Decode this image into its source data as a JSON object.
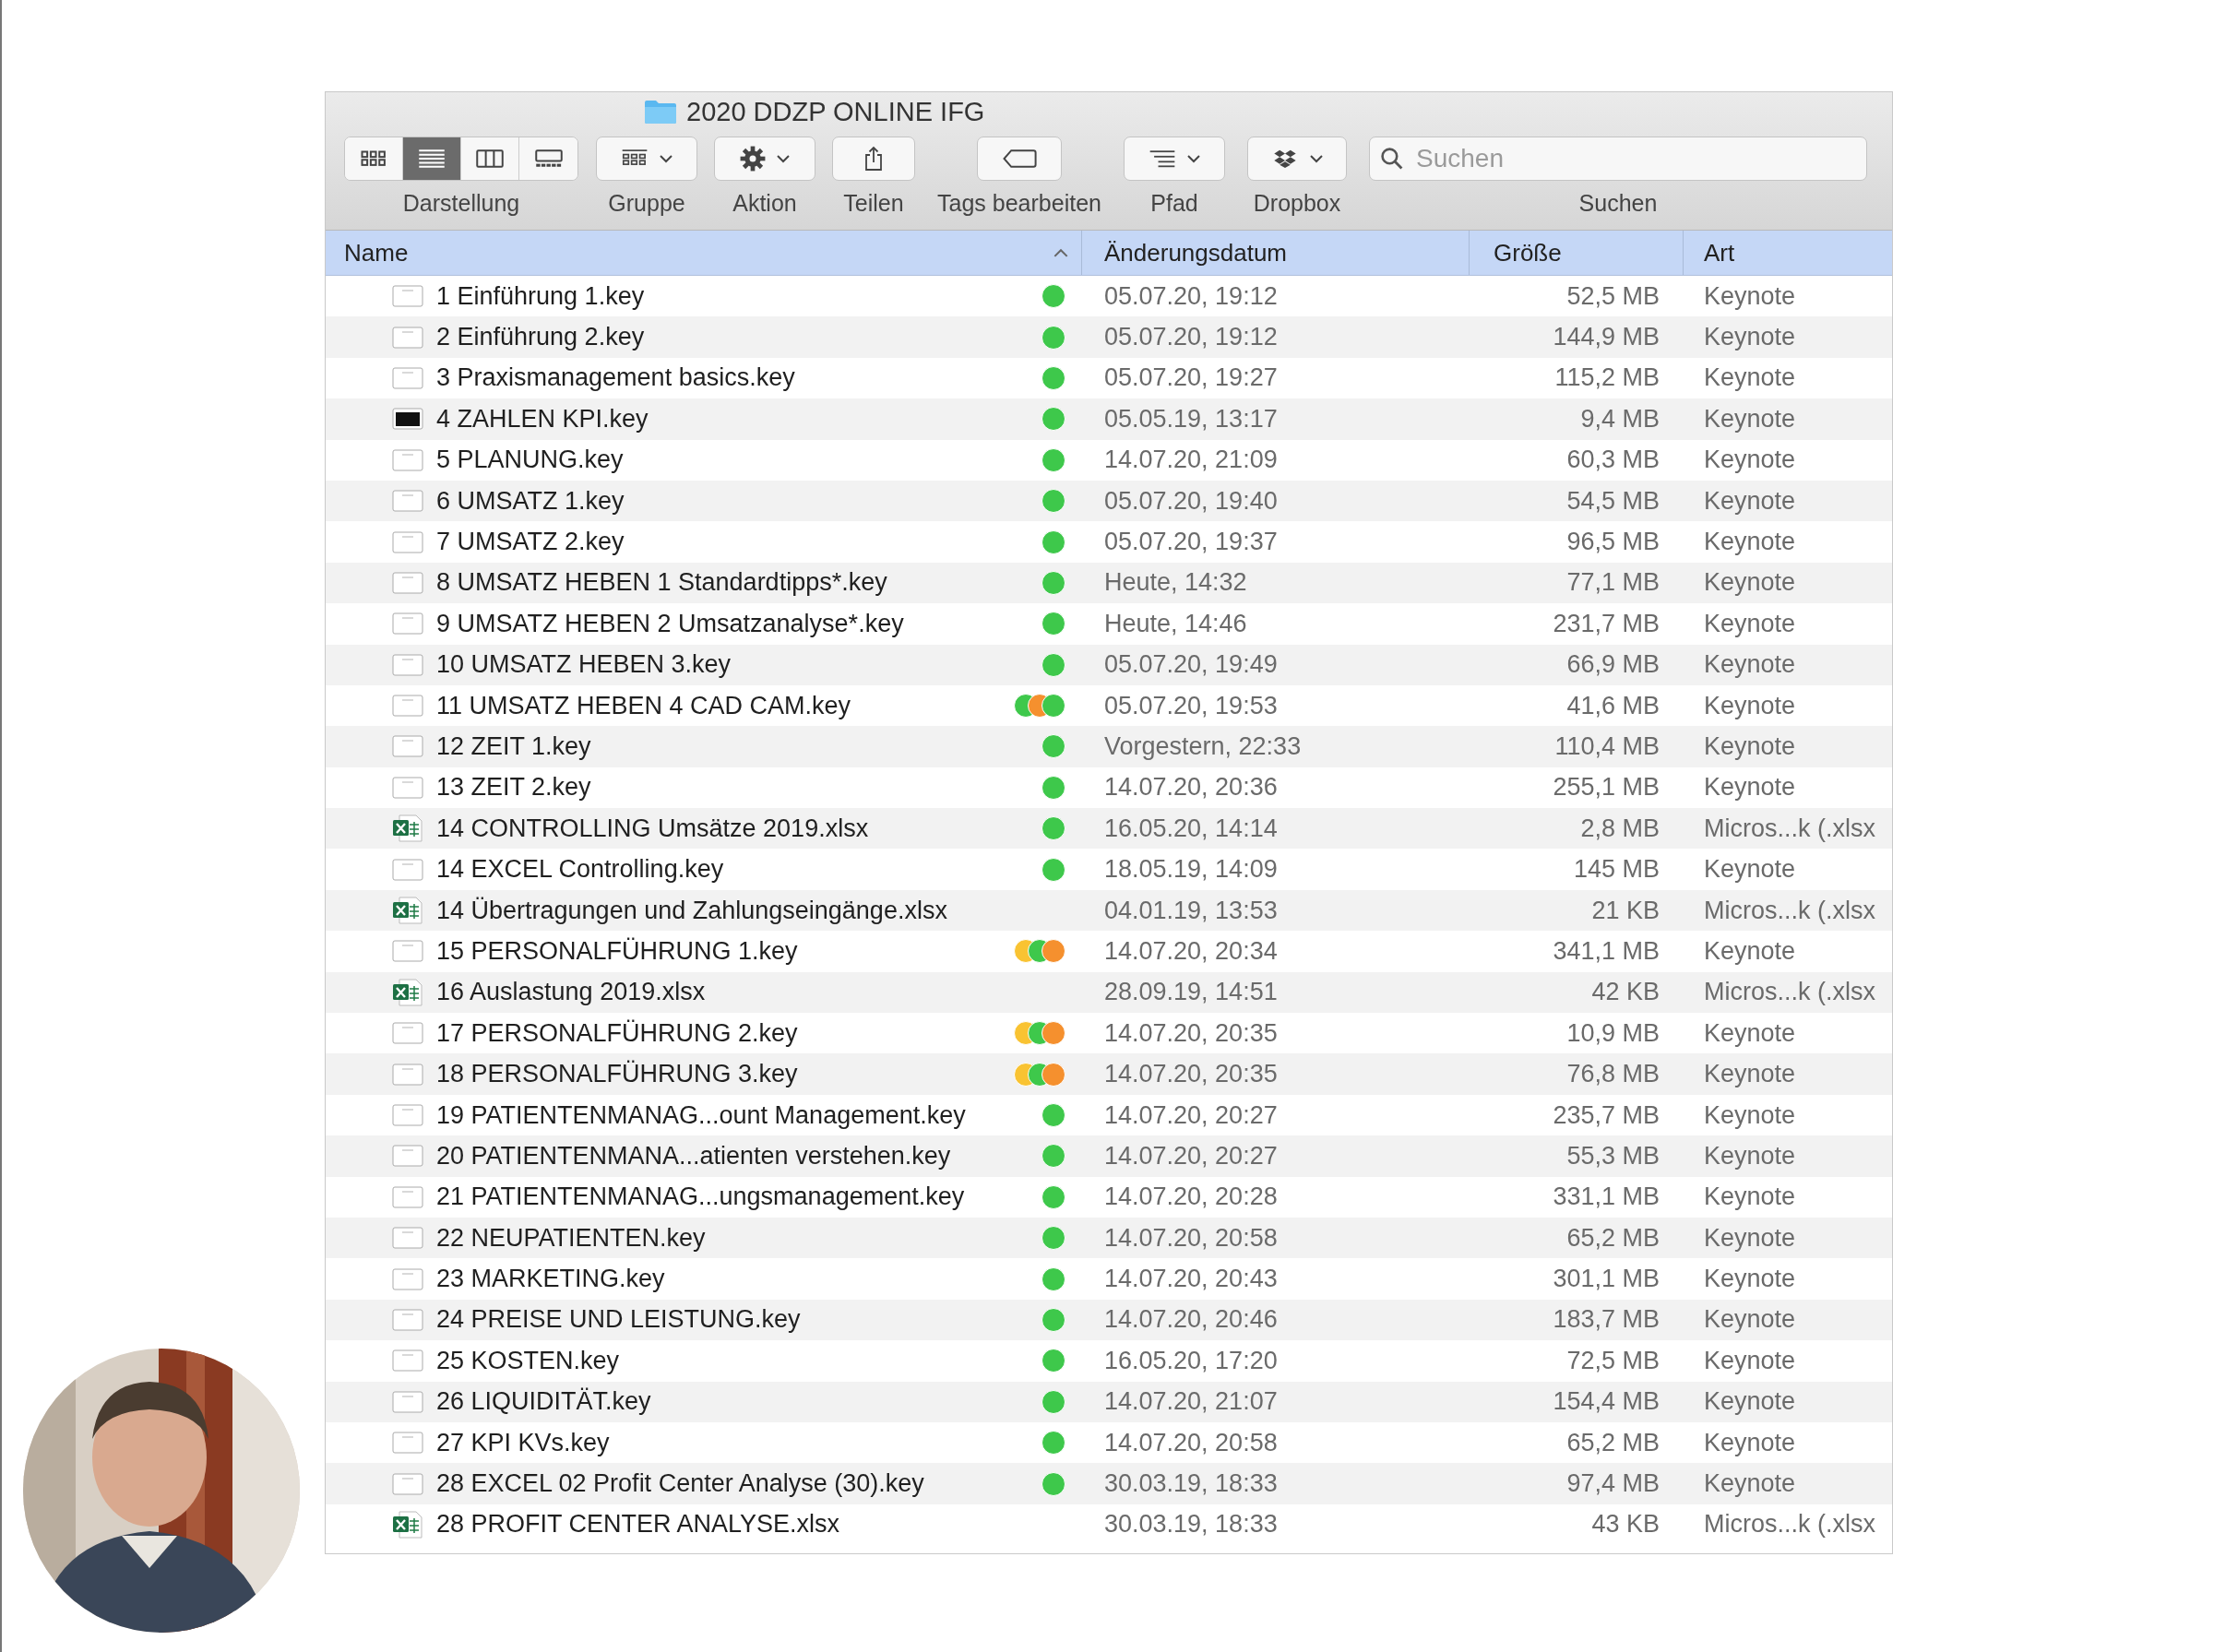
{
  "window": {
    "title": "2020 DDZP ONLINE IFG"
  },
  "toolbar": [
    {
      "kind": "view",
      "label": "Darstellung",
      "buttons": [
        {
          "kind": "icons",
          "selected": false
        },
        {
          "kind": "list",
          "selected": true
        },
        {
          "kind": "columns",
          "selected": false
        },
        {
          "kind": "gallery",
          "selected": false
        }
      ]
    },
    {
      "kind": "group",
      "label": "Gruppe"
    },
    {
      "kind": "action",
      "label": "Aktion"
    },
    {
      "kind": "share",
      "label": "Teilen"
    },
    {
      "kind": "tags",
      "label": "Tags bearbeiten"
    },
    {
      "kind": "path",
      "label": "Pfad"
    },
    {
      "kind": "dropbox",
      "label": "Dropbox"
    },
    {
      "kind": "search",
      "label": "Suchen",
      "placeholder": "Suchen"
    }
  ],
  "columns": [
    {
      "label": "Name",
      "sorted": true
    },
    {
      "label": "Änderungsdatum",
      "sorted": false
    },
    {
      "label": "Größe",
      "sorted": false
    },
    {
      "label": "Art",
      "sorted": false
    }
  ],
  "rows": [
    {
      "name": "1 Einführung 1.key",
      "kind": "keynote",
      "tags": [
        {
          "color": "#3ec84b"
        }
      ],
      "date": "05.07.20, 19:12",
      "size": "52,5 MB",
      "type": "Keynote"
    },
    {
      "name": "2 Einführung 2.key",
      "kind": "keynote",
      "tags": [
        {
          "color": "#3ec84b"
        }
      ],
      "date": "05.07.20, 19:12",
      "size": "144,9 MB",
      "type": "Keynote"
    },
    {
      "name": "3 Praxismanagement basics.key",
      "kind": "keynote",
      "tags": [
        {
          "color": "#3ec84b"
        }
      ],
      "date": "05.07.20, 19:27",
      "size": "115,2 MB",
      "type": "Keynote"
    },
    {
      "name": "4 ZAHLEN KPI.key",
      "kind": "keynote-dark",
      "tags": [
        {
          "color": "#3ec84b"
        }
      ],
      "date": "05.05.19, 13:17",
      "size": "9,4 MB",
      "type": "Keynote"
    },
    {
      "name": "5 PLANUNG.key",
      "kind": "keynote",
      "tags": [
        {
          "color": "#3ec84b"
        }
      ],
      "date": "14.07.20, 21:09",
      "size": "60,3 MB",
      "type": "Keynote"
    },
    {
      "name": "6 UMSATZ 1.key",
      "kind": "keynote",
      "tags": [
        {
          "color": "#3ec84b"
        }
      ],
      "date": "05.07.20, 19:40",
      "size": "54,5 MB",
      "type": "Keynote"
    },
    {
      "name": "7 UMSATZ 2.key",
      "kind": "keynote",
      "tags": [
        {
          "color": "#3ec84b"
        }
      ],
      "date": "05.07.20, 19:37",
      "size": "96,5 MB",
      "type": "Keynote"
    },
    {
      "name": "8 UMSATZ HEBEN 1 Standardtipps*.key",
      "kind": "keynote",
      "tags": [
        {
          "color": "#3ec84b"
        }
      ],
      "date": "Heute, 14:32",
      "size": "77,1 MB",
      "type": "Keynote"
    },
    {
      "name": "9 UMSATZ HEBEN 2 Umsatzanalyse*.key",
      "kind": "keynote",
      "tags": [
        {
          "color": "#3ec84b"
        }
      ],
      "date": "Heute, 14:46",
      "size": "231,7 MB",
      "type": "Keynote"
    },
    {
      "name": "10 UMSATZ HEBEN 3.key",
      "kind": "keynote",
      "tags": [
        {
          "color": "#3ec84b"
        }
      ],
      "date": "05.07.20, 19:49",
      "size": "66,9 MB",
      "type": "Keynote"
    },
    {
      "name": "11 UMSATZ HEBEN 4 CAD CAM.key",
      "kind": "keynote",
      "tags": [
        {
          "color": "#3ec84b"
        },
        {
          "color": "#f5902e"
        },
        {
          "color": "#3ec84b"
        }
      ],
      "date": "05.07.20, 19:53",
      "size": "41,6 MB",
      "type": "Keynote"
    },
    {
      "name": "12 ZEIT 1.key",
      "kind": "keynote",
      "tags": [
        {
          "color": "#3ec84b"
        }
      ],
      "date": "Vorgestern, 22:33",
      "size": "110,4 MB",
      "type": "Keynote"
    },
    {
      "name": "13 ZEIT 2.key",
      "kind": "keynote",
      "tags": [
        {
          "color": "#3ec84b"
        }
      ],
      "date": "14.07.20, 20:36",
      "size": "255,1 MB",
      "type": "Keynote"
    },
    {
      "name": "14 CONTROLLING Umsätze 2019.xlsx",
      "kind": "excel",
      "tags": [
        {
          "color": "#3ec84b"
        }
      ],
      "date": "16.05.20, 14:14",
      "size": "2,8 MB",
      "type": "Micros...k (.xlsx"
    },
    {
      "name": "14 EXCEL Controlling.key",
      "kind": "keynote",
      "tags": [
        {
          "color": "#3ec84b"
        }
      ],
      "date": "18.05.19, 14:09",
      "size": "145 MB",
      "type": "Keynote"
    },
    {
      "name": "14 Übertragungen und Zahlungseingänge.xlsx",
      "kind": "excel",
      "tags": [],
      "date": "04.01.19, 13:53",
      "size": "21 KB",
      "type": "Micros...k (.xlsx"
    },
    {
      "name": "15 PERSONALFÜHRUNG 1.key",
      "kind": "keynote",
      "tags": [
        {
          "color": "#f9c332"
        },
        {
          "color": "#3ec84b"
        },
        {
          "color": "#f5902e"
        }
      ],
      "date": "14.07.20, 20:34",
      "size": "341,1 MB",
      "type": "Keynote"
    },
    {
      "name": "16 Auslastung 2019.xlsx",
      "kind": "excel",
      "tags": [],
      "date": "28.09.19, 14:51",
      "size": "42 KB",
      "type": "Micros...k (.xlsx"
    },
    {
      "name": "17 PERSONALFÜHRUNG 2.key",
      "kind": "keynote",
      "tags": [
        {
          "color": "#f9c332"
        },
        {
          "color": "#3ec84b"
        },
        {
          "color": "#f5902e"
        }
      ],
      "date": "14.07.20, 20:35",
      "size": "10,9 MB",
      "type": "Keynote"
    },
    {
      "name": "18 PERSONALFÜHRUNG 3.key",
      "kind": "keynote",
      "tags": [
        {
          "color": "#f9c332"
        },
        {
          "color": "#3ec84b"
        },
        {
          "color": "#f5902e"
        }
      ],
      "date": "14.07.20, 20:35",
      "size": "76,8 MB",
      "type": "Keynote"
    },
    {
      "name": "19 PATIENTENMANAG...ount Management.key",
      "kind": "keynote",
      "tags": [
        {
          "color": "#3ec84b"
        }
      ],
      "date": "14.07.20, 20:27",
      "size": "235,7 MB",
      "type": "Keynote"
    },
    {
      "name": "20 PATIENTENMANA...atienten verstehen.key",
      "kind": "keynote",
      "tags": [
        {
          "color": "#3ec84b"
        }
      ],
      "date": "14.07.20, 20:27",
      "size": "55,3 MB",
      "type": "Keynote"
    },
    {
      "name": "21 PATIENTENMANAG...ungsmanagement.key",
      "kind": "keynote",
      "tags": [
        {
          "color": "#3ec84b"
        }
      ],
      "date": "14.07.20, 20:28",
      "size": "331,1 MB",
      "type": "Keynote"
    },
    {
      "name": "22 NEUPATIENTEN.key",
      "kind": "keynote",
      "tags": [
        {
          "color": "#3ec84b"
        }
      ],
      "date": "14.07.20, 20:58",
      "size": "65,2 MB",
      "type": "Keynote"
    },
    {
      "name": "23 MARKETING.key",
      "kind": "keynote",
      "tags": [
        {
          "color": "#3ec84b"
        }
      ],
      "date": "14.07.20, 20:43",
      "size": "301,1 MB",
      "type": "Keynote"
    },
    {
      "name": "24 PREISE UND LEISTUNG.key",
      "kind": "keynote",
      "tags": [
        {
          "color": "#3ec84b"
        }
      ],
      "date": "14.07.20, 20:46",
      "size": "183,7 MB",
      "type": "Keynote"
    },
    {
      "name": "25 KOSTEN.key",
      "kind": "keynote",
      "tags": [
        {
          "color": "#3ec84b"
        }
      ],
      "date": "16.05.20, 17:20",
      "size": "72,5 MB",
      "type": "Keynote"
    },
    {
      "name": "26 LIQUIDITÄT.key",
      "kind": "keynote",
      "tags": [
        {
          "color": "#3ec84b"
        }
      ],
      "date": "14.07.20, 21:07",
      "size": "154,4 MB",
      "type": "Keynote"
    },
    {
      "name": "27 KPI KVs.key",
      "kind": "keynote",
      "tags": [
        {
          "color": "#3ec84b"
        }
      ],
      "date": "14.07.20, 20:58",
      "size": "65,2 MB",
      "type": "Keynote"
    },
    {
      "name": "28 EXCEL 02 Profit Center Analyse (30).key",
      "kind": "keynote",
      "tags": [
        {
          "color": "#3ec84b"
        }
      ],
      "date": "30.03.19, 18:33",
      "size": "97,4 MB",
      "type": "Keynote"
    },
    {
      "name": "28 PROFIT CENTER ANALYSE.xlsx",
      "kind": "excel",
      "tags": [],
      "date": "30.03.19, 18:33",
      "size": "43 KB",
      "type": "Micros...k (.xlsx"
    }
  ]
}
